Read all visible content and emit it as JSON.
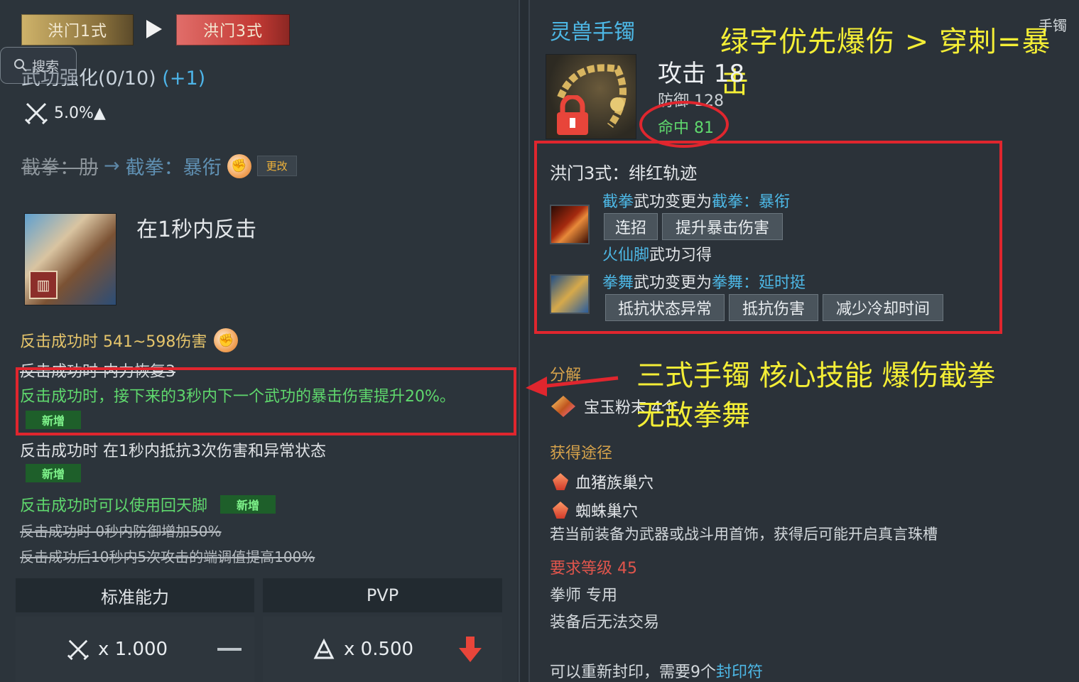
{
  "left_panel": {
    "stage_tabs": [
      {
        "label": "洪门1式"
      },
      {
        "label": "洪门3式"
      }
    ],
    "search": {
      "label": "搜索"
    },
    "enhance": {
      "title": "武功强化(0/10)",
      "bonus": "(+1)"
    },
    "attack_boost": {
      "value": "5.0%▲"
    },
    "skill_change": {
      "old": "截拳：肋",
      "new": "截拳：暴衔",
      "change_button": "更改"
    },
    "skill": {
      "description": "在1秒内反击"
    },
    "effects": [
      {
        "text": "反击成功时 541~598伤害"
      },
      {
        "text": "反击成功时 内力恢复3"
      },
      {
        "text": "反击成功时，接下来的3秒内下一个武功的暴击伤害提升20%。"
      },
      {
        "text": "反击成功时 在1秒内抵抗3次伤害和异常状态"
      },
      {
        "text": "反击成功时可以使用回天脚"
      },
      {
        "text": "反击成功时 0秒内防御增加50%"
      },
      {
        "text": "反击成功后10秒内5次攻击的端调值提高100%"
      }
    ],
    "new_badge": "新增",
    "stats": {
      "standard_label": "标准能力",
      "pvp_label": "PVP",
      "standard_value": "x 1.000",
      "pvp_value": "x 0.500"
    }
  },
  "right_panel": {
    "item_name": "灵兽手镯",
    "item_type": "手镯",
    "annotation_top": "绿字优先爆伤 > 穿刺=暴击",
    "attack": "攻击 18",
    "defense": "防御 128",
    "hit": "命中 81",
    "set_title": "洪门3式：绯红轨迹",
    "line1": {
      "pre": "截拳",
      "mid": "武功变更为",
      "post": "截拳：暴衔"
    },
    "tags1": [
      "连招",
      "提升暴击伤害"
    ],
    "line2": {
      "pre": "火仙脚",
      "mid": "武功习得"
    },
    "line3": {
      "pre": "拳舞",
      "mid": "武功变更为",
      "post": "拳舞：延时挺"
    },
    "tags2": [
      "抵抗状态异常",
      "抵抗伤害",
      "减少冷却时间"
    ],
    "decompose_label": "分解",
    "material": "宝玉粉末 4个",
    "annotation_mid1": "三式手镯 核心技能 爆伤截拳",
    "annotation_mid2": "无敌拳舞",
    "obtain_label": "获得途径",
    "sources": [
      "血猪族巢穴",
      "蜘蛛巢穴"
    ],
    "slot_note": "若当前装备为武器或战斗用首饰，获得后可能开启真言珠槽",
    "required_level": "要求等级 45",
    "class_only": "拳师 专用",
    "no_trade": "装备后无法交易",
    "reseal": {
      "pre": "可以重新封印，需要9个",
      "post": "封印符"
    }
  },
  "colors": {
    "annotation_yellow": "#f4ee36",
    "highlight_red": "#e0262e",
    "green_text": "#5fd86d",
    "blue_text": "#4db8e6"
  }
}
